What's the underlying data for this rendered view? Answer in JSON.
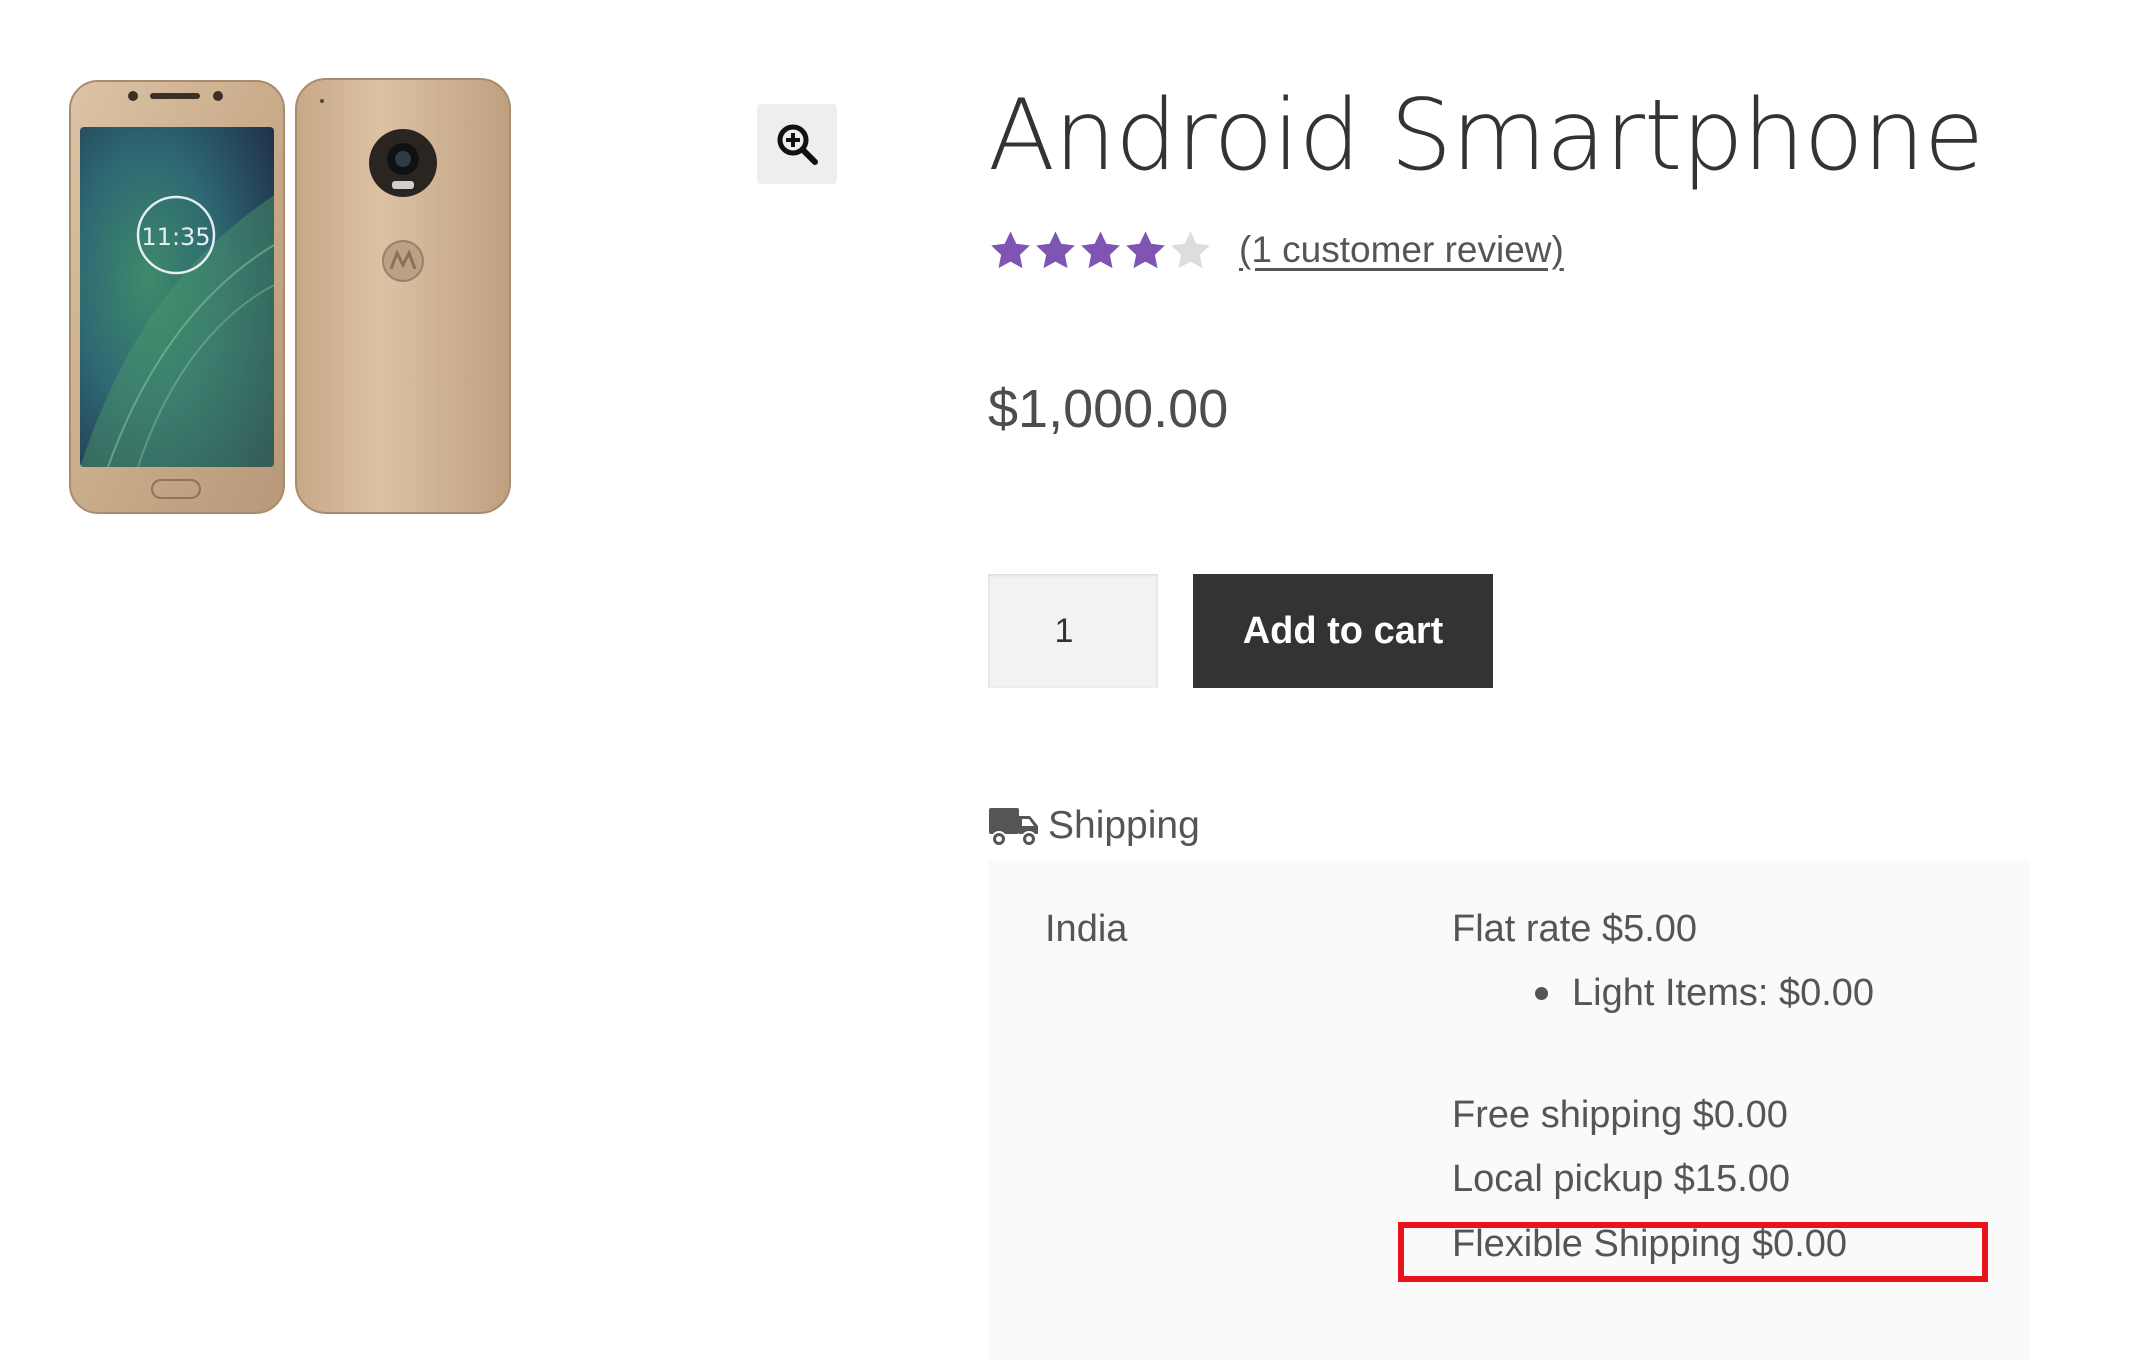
{
  "product": {
    "title": "Android Smartphone",
    "rating_value": 4,
    "rating_max": 5,
    "review_link": "(1 customer review)",
    "price": "$1,000.00",
    "image_alt": "motorola-phone-gold",
    "quantity": "1",
    "add_to_cart_label": "Add to cart"
  },
  "icons": {
    "zoom": "zoom-in-icon",
    "shipping": "truck-icon",
    "star_filled_color": "#7f54b3",
    "star_empty_color": "#dddddd"
  },
  "shipping": {
    "heading": "Shipping",
    "country": "India",
    "methods": [
      {
        "label": "Flat rate $5.00"
      },
      {
        "label": "Free shipping $0.00"
      },
      {
        "label": "Local pickup $15.00"
      },
      {
        "label": "Flexible Shipping $0.00"
      }
    ],
    "flat_rate_items": [
      "Light Items: $0.00"
    ]
  },
  "highlight": {
    "color": "#e8141b",
    "target": "Flexible Shipping $0.00"
  }
}
